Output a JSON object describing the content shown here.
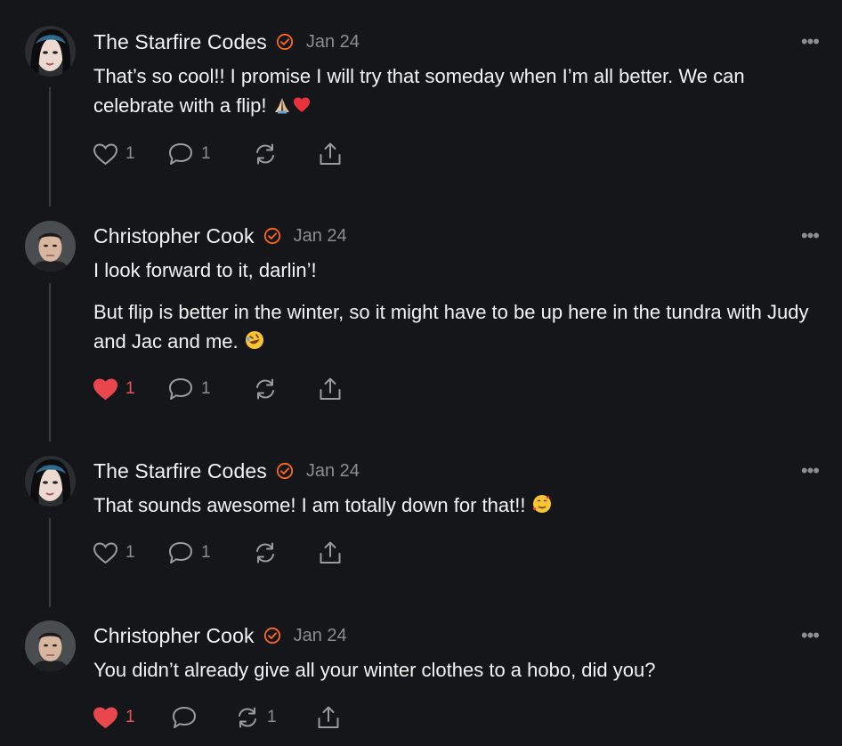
{
  "colors": {
    "background": "#151619",
    "text": "#f4f4f5",
    "muted": "#8c8d92",
    "verified": "#ff6719",
    "liked": "#e8565a"
  },
  "posts": [
    {
      "author": "The Starfire Codes",
      "date": "Jan 24",
      "paragraphs": [
        "That’s so cool!! I promise I will try that someday when I’m all better. We can celebrate with a flip!"
      ],
      "emoji": [
        "folded-hands-emoji",
        "red-heart-emoji"
      ],
      "likes": "1",
      "liked": false,
      "comments": "1",
      "restacks": ""
    },
    {
      "author": "Christopher Cook",
      "date": "Jan 24",
      "paragraphs": [
        "I look forward to it, darlin’!",
        "But flip is better in the winter, so it might have to be up here in the tundra with Judy and Jac and me."
      ],
      "emoji": [
        "rolling-laughing-emoji"
      ],
      "likes": "1",
      "liked": true,
      "comments": "1",
      "restacks": ""
    },
    {
      "author": "The Starfire Codes",
      "date": "Jan 24",
      "paragraphs": [
        "That sounds awesome! I am totally down for that!!"
      ],
      "emoji": [
        "smiling-hearts-emoji"
      ],
      "likes": "1",
      "liked": false,
      "comments": "1",
      "restacks": ""
    },
    {
      "author": "Christopher Cook",
      "date": "Jan 24",
      "paragraphs": [
        "You didn’t already give all your winter clothes to a hobo, did you?"
      ],
      "emoji": [],
      "likes": "1",
      "liked": true,
      "comments": "",
      "restacks": "1"
    }
  ]
}
